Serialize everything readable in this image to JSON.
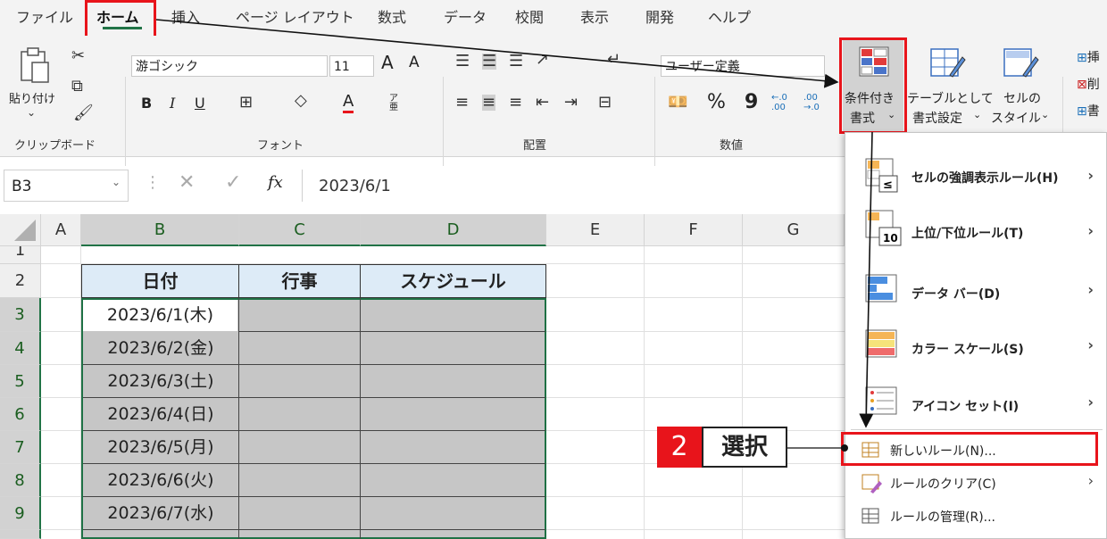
{
  "tabs": [
    "ファイル",
    "ホーム",
    "挿入",
    "ページ レイアウト",
    "数式",
    "データ",
    "校閲",
    "表示",
    "開発",
    "ヘルプ"
  ],
  "active_tab": "ホーム",
  "ribbon": {
    "clipboard": {
      "paste_label": "貼り付け",
      "group_label": "クリップボード"
    },
    "font": {
      "font_name": "游ゴシック",
      "font_size": "11",
      "group_label": "フォント",
      "grow": "A",
      "shrink": "A",
      "bold": "B",
      "italic": "I",
      "underline": "U",
      "font_color": "A",
      "phonetic": "ア亜"
    },
    "alignment": {
      "group_label": "配置"
    },
    "number": {
      "format_value": "ユーザー定義",
      "group_label": "数値",
      "percent": "%",
      "comma": "9",
      "inc_decimal": "←.0 .00",
      "dec_decimal": ".00 →.0"
    },
    "styles": {
      "cond_format_line1": "条件付き",
      "cond_format_line2": "書式",
      "table_line1": "テーブルとして",
      "table_line2": "書式設定",
      "cell_style_line1": "セルの",
      "cell_style_line2": "スタイル"
    },
    "cells": {
      "insert": "挿",
      "delete": "削",
      "format": "書"
    }
  },
  "formula_bar": {
    "name_box": "B3",
    "fx": "fx",
    "value": "2023/6/1"
  },
  "columns": [
    "A",
    "B",
    "C",
    "D",
    "E",
    "F",
    "G"
  ],
  "rows": [
    "1",
    "2",
    "3",
    "4",
    "5",
    "6",
    "7",
    "8",
    "9"
  ],
  "table": {
    "headers": [
      "日付",
      "行事",
      "スケジュール"
    ],
    "dates": [
      "2023/6/1(木)",
      "2023/6/2(金)",
      "2023/6/3(土)",
      "2023/6/4(日)",
      "2023/6/5(月)",
      "2023/6/6(火)",
      "2023/6/7(水)"
    ]
  },
  "menu": {
    "items": [
      {
        "label": "セルの強調表示ルール(H)",
        "icon": "highlight-rules-icon"
      },
      {
        "label": "上位/下位ルール(T)",
        "icon": "top-bottom-icon",
        "icon_text": "10"
      },
      {
        "label": "データ バー(D)",
        "icon": "data-bar-icon"
      },
      {
        "label": "カラー スケール(S)",
        "icon": "color-scale-icon"
      },
      {
        "label": "アイコン セット(I)",
        "icon": "icon-set-icon"
      },
      {
        "label": "新しいルール(N)...",
        "icon": "new-rule-icon"
      },
      {
        "label": "ルールのクリア(C)",
        "icon": "clear-rules-icon"
      },
      {
        "label": "ルールの管理(R)...",
        "icon": "manage-rules-icon"
      }
    ]
  },
  "callout": {
    "number": "2",
    "text": "選択"
  },
  "colors": {
    "red_highlight": "#e8141b",
    "excel_green": "#217346",
    "header_fill": "#ddebf7",
    "selected_fill": "#c6c6c6",
    "table_border": "#1f7145"
  }
}
